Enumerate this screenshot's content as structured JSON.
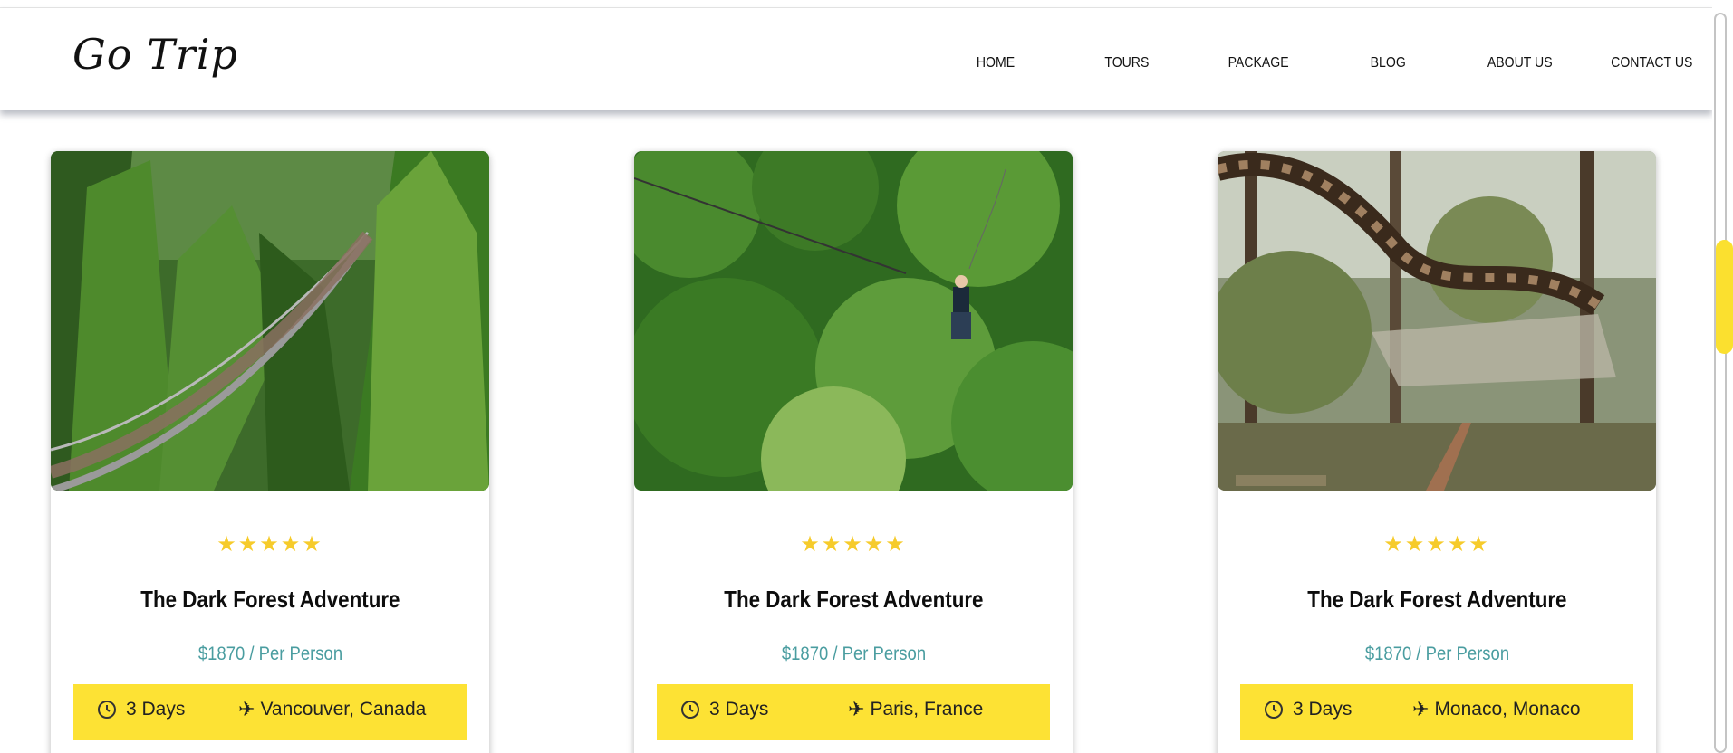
{
  "brand": {
    "logo_text": "Go Trip"
  },
  "nav": {
    "items": [
      {
        "label": "HOME"
      },
      {
        "label": "TOURS"
      },
      {
        "label": "PACKAGE"
      },
      {
        "label": "BLOG"
      },
      {
        "label": "ABOUT US"
      },
      {
        "label": "CONTACT US"
      }
    ]
  },
  "colors": {
    "accent": "#fde234",
    "star": "#f6cb2b",
    "price": "#4a9da0"
  },
  "cards": [
    {
      "image": "suspension-bridge-forest",
      "rating": 5,
      "stars": "★★★★★",
      "title": "The Dark Forest Adventure",
      "price": "$1870 / Per Person",
      "duration": "3 Days",
      "location": "Vancouver, Canada"
    },
    {
      "image": "zipline-jungle",
      "rating": 5,
      "stars": "★★★★★",
      "title": "The Dark Forest Adventure",
      "price": "$1870 / Per Person",
      "duration": "3 Days",
      "location": "Paris, France"
    },
    {
      "image": "rope-course-forest",
      "rating": 5,
      "stars": "★★★★★",
      "title": "The Dark Forest Adventure",
      "price": "$1870 / Per Person",
      "duration": "3 Days",
      "location": "Monaco, Monaco"
    }
  ]
}
